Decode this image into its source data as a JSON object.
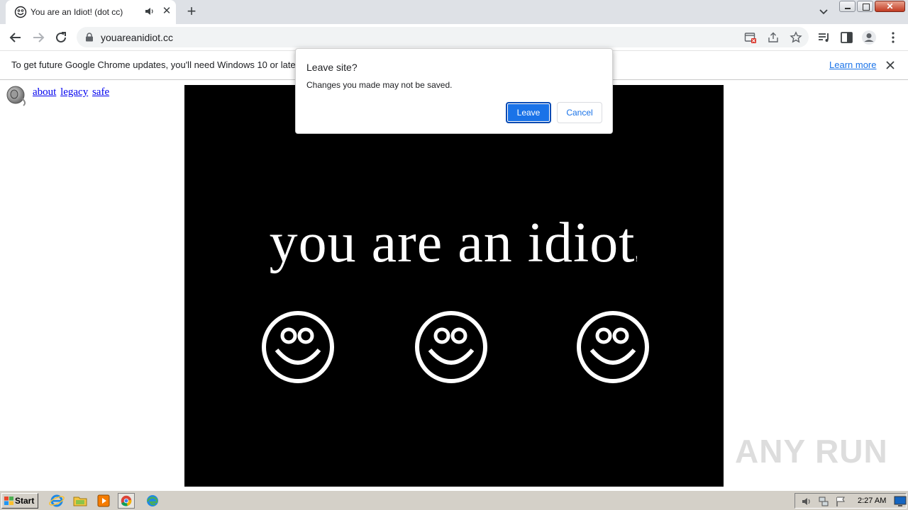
{
  "tab": {
    "title": "You are an Idiot! (dot cc)",
    "favicon": "smiley-icon",
    "audio_icon": "speaker-icon"
  },
  "toolbar": {
    "url": "youareanidiot.cc"
  },
  "infobar": {
    "message": "To get future Google Chrome updates, you'll need Windows 10 or later.",
    "learn_more": "Learn more"
  },
  "page": {
    "links": [
      "about",
      "legacy",
      "safe"
    ],
    "headline": "you are an idiot",
    "headline_suffix": "!"
  },
  "dialog": {
    "title": "Leave site?",
    "message": "Changes you made may not be saved.",
    "leave_label": "Leave",
    "cancel_label": "Cancel"
  },
  "watermark": {
    "text": "ANY RUN"
  },
  "taskbar": {
    "start_label": "Start",
    "clock": "2:27 AM"
  },
  "colors": {
    "accent": "#1a73e8",
    "tabstrip": "#dee1e6",
    "video_bg": "#000000",
    "taskbar": "#d4d0c8"
  }
}
